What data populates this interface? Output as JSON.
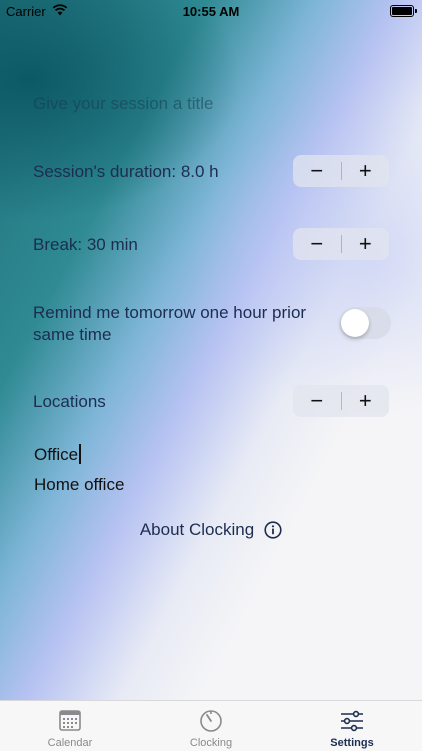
{
  "status_bar": {
    "carrier": "Carrier",
    "time": "10:55 AM"
  },
  "session": {
    "title_placeholder": "Give your session a title",
    "duration_label": "Session's duration: 8.0 h",
    "break_label": "Break: 30 min",
    "reminder_label": "Remind me tomorrow one hour prior same time",
    "reminder_on": false,
    "locations_label": "Locations",
    "stepper_minus": "−",
    "stepper_plus": "+"
  },
  "locations": [
    "Office",
    "Home office"
  ],
  "about": {
    "label": "About Clocking",
    "icon": "info-icon"
  },
  "tabs": [
    {
      "label": "Calendar",
      "icon": "calendar-icon",
      "active": false
    },
    {
      "label": "Clocking",
      "icon": "stopwatch-icon",
      "active": false
    },
    {
      "label": "Settings",
      "icon": "sliders-icon",
      "active": true
    }
  ],
  "colors": {
    "text": "#1d2d50",
    "teal": "#1f6f78",
    "lavender": "#b6c2f2"
  }
}
